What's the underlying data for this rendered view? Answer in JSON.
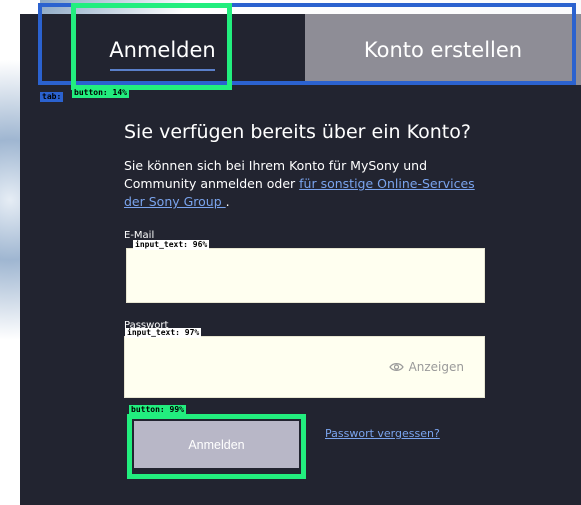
{
  "tabs": {
    "login_label": "Anmelden",
    "register_label": "Konto erstellen"
  },
  "form": {
    "heading": "Sie verfügen bereits über ein Konto?",
    "intro_text": "Sie können sich bei Ihrem Konto für MySony und Community anmelden oder ",
    "intro_link": "für sonstige Online-Services der Sony Group ",
    "intro_end": ".",
    "email_label": "E-Mail",
    "email_value": "",
    "password_label": "Passwort",
    "password_value": "",
    "show_password_label": "Anzeigen",
    "submit_label": "Anmelden",
    "forgot_password_label": "Passwort vergessen?"
  },
  "detections": {
    "tab_label": "tab:",
    "tab_button_label": "button: 14%",
    "email_label": "input_text: 96%",
    "password_label": "input_text: 97%",
    "submit_label": "button: 99%"
  },
  "colors": {
    "panel": "#222430",
    "inactive_tab": "#8e8d96",
    "submit_button": "#b8b7c7",
    "link": "#7aa4ee",
    "detection_green": "#22ee7e",
    "detection_blue": "#2b62cf"
  },
  "icons": {
    "show_password": "eye-icon"
  }
}
